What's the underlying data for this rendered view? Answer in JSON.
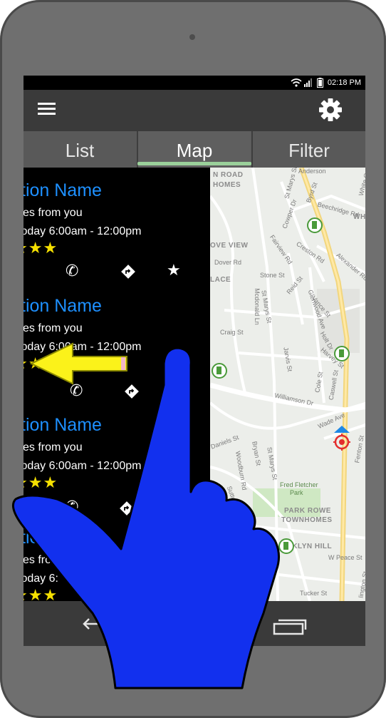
{
  "status": {
    "time": "02:18 PM"
  },
  "tabs": [
    {
      "label": "List"
    },
    {
      "label": "Map"
    },
    {
      "label": "Filter"
    }
  ],
  "stations": [
    {
      "name": "tion Name",
      "distance": "es from you",
      "hours": "today 6:00am - 12:00pm",
      "stars": "★★★"
    },
    {
      "name": "tion Name",
      "distance": "es from you",
      "hours": "today 6:00am - 12:00pm",
      "stars": "★★"
    },
    {
      "name": "tion Name",
      "distance": "es from you",
      "hours": "today 6:00am - 12:00pm",
      "stars": "★★★"
    },
    {
      "name": "tion Name",
      "distance": "es from you",
      "hours": "today 6:",
      "stars": "★★★"
    }
  ],
  "map_labels": {
    "road_homes_1": "N ROAD",
    "road_homes_2": "HOMES",
    "ove_view": "OVE VIEW",
    "lace": "LACE",
    "park_rowe_1": "PARK ROWE",
    "park_rowe_2": "TOWNHOMES",
    "oklyn_hill": "OKLYN HILL",
    "fred_fletcher_1": "Fred Fletcher",
    "fred_fletcher_2": "Park",
    "whi": "WHI",
    "glenwood": "Glenwood Ave",
    "wade": "Wade Ave",
    "dover": "Dover Rd",
    "craig": "Craig St",
    "williamson": "Williamson Dr",
    "cowper": "Cowper Dr",
    "fairview": "Fairview Rd",
    "stone": "Stone St",
    "reid": "Reid St",
    "vance": "Vance St",
    "holt": "Holt Dr",
    "harvey": "Harvey St",
    "cole": "Cole St",
    "jarvis": "Jarvis St",
    "caswell": "Caswell St",
    "creston": "Creston Rd",
    "alexander": "Alexander Rd",
    "beechridge": "Beechridge Rd",
    "byrd": "Byrd St",
    "anderson": "Anderson",
    "marys": "St Marys St",
    "mcdonald": "Mcdonald Ln",
    "daniels": "Daniels St",
    "bryan": "Bryan St",
    "woodburn": "Woodburn Rd",
    "sutton": "Sutton Dr",
    "peace": "W Peace St",
    "tucker": "Tucker St",
    "fenton": "Fenton St",
    "white_oak": "White Oak",
    "lington": "lington St"
  }
}
